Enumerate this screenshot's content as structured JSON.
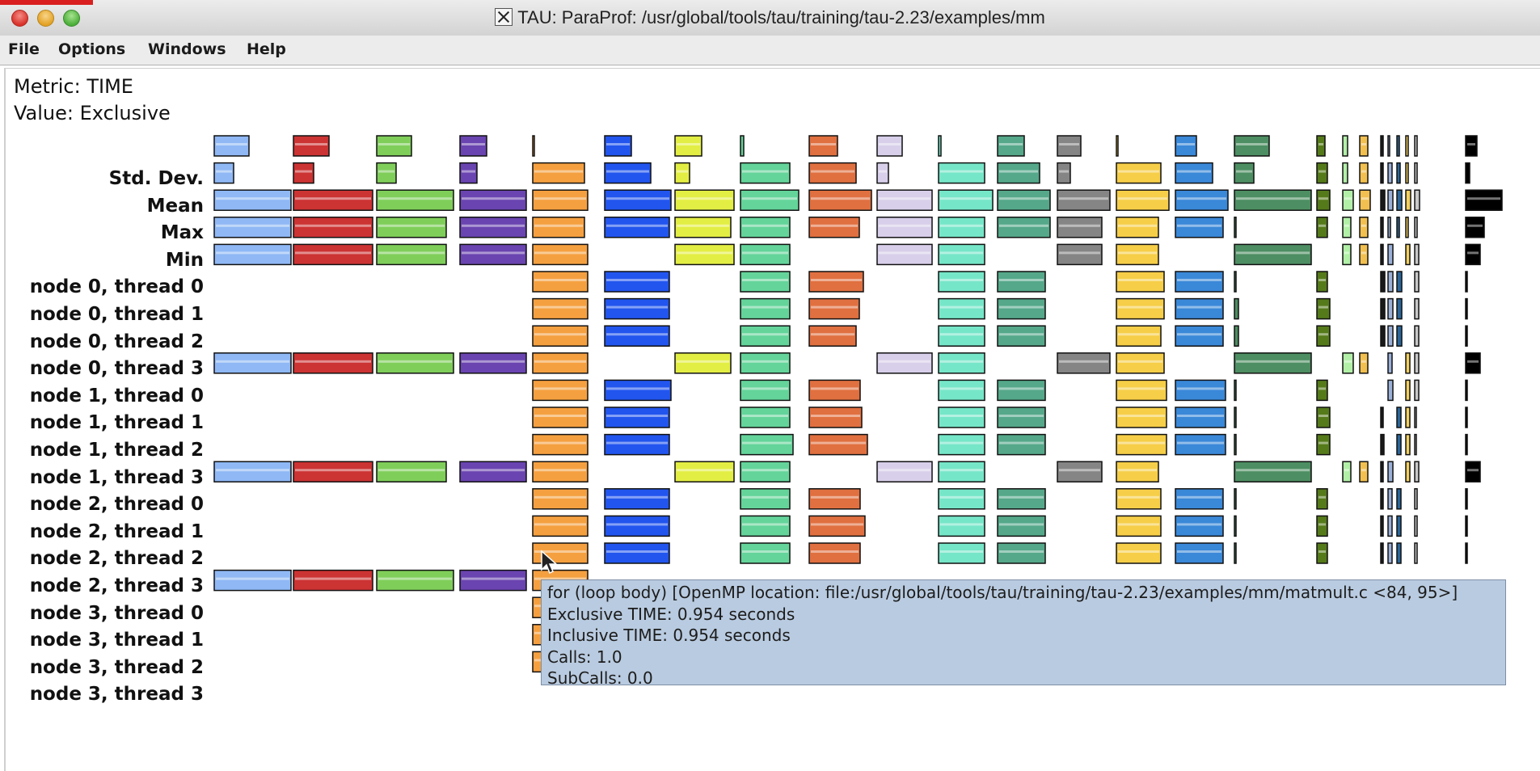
{
  "window": {
    "title": "TAU: ParaProf: /usr/global/tools/tau/training/tau-2.23/examples/mm"
  },
  "menu": [
    "File",
    "Options",
    "Windows",
    "Help"
  ],
  "info": {
    "metric": "Metric: TIME",
    "value": "Value: Exclusive"
  },
  "rows": [
    "Std. Dev.",
    "Mean",
    "Max",
    "Min",
    "node 0, thread 0",
    "node 0, thread 1",
    "node 0, thread 2",
    "node 0, thread 3",
    "node 1, thread 0",
    "node 1, thread 1",
    "node 1, thread 2",
    "node 1, thread 3",
    "node 2, thread 0",
    "node 2, thread 1",
    "node 2, thread 2",
    "node 2, thread 3",
    "node 3, thread 0",
    "node 3, thread 1",
    "node 3, thread 2",
    "node 3, thread 3"
  ],
  "function_colors": [
    "#8fb8f5",
    "#cc3333",
    "#7fce5a",
    "#6a44b0",
    "#f5a040",
    "#2255ee",
    "#e3ee44",
    "#64d49a",
    "#e07040",
    "#d8d0ea",
    "#76e6c8",
    "#55a88a",
    "#858585",
    "#f6ce48",
    "#3a88d8",
    "#4d8e62",
    "#557a1a",
    "#b2f0a8",
    "#f2c050",
    "#1a1a1a",
    "#9ab0d8",
    "#2a6699",
    "#f2d060",
    "#c9c9c9",
    "#000000"
  ],
  "tooltip": {
    "line1": "for (loop body) [OpenMP location: file:/usr/global/tools/tau/training/tau-2.23/examples/mm/matmult.c <84, 95>]",
    "line2": "Exclusive TIME: 0.954 seconds",
    "line3": "Inclusive TIME: 0.954 seconds",
    "line4": "Calls: 1.0",
    "line5": "SubCalls: 0.0"
  }
}
